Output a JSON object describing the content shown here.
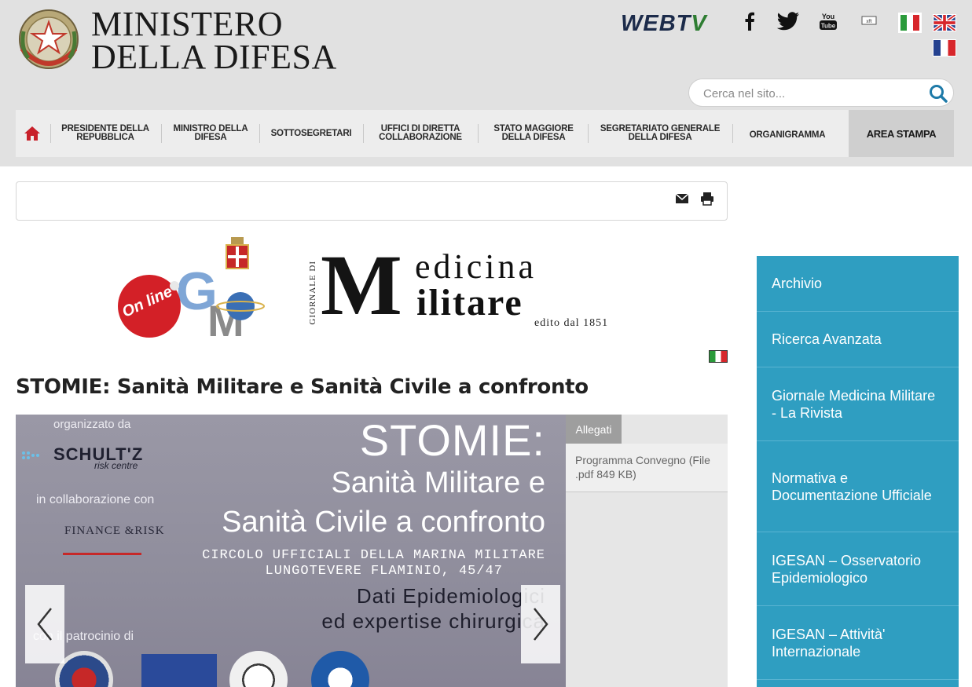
{
  "header": {
    "brand_line1": "MINISTERO",
    "brand_line2": "DELLA DIFESA",
    "emblem_icon": "repubblica-italiana-emblem",
    "webtv_label_a": "WEBT",
    "webtv_label_b": "V",
    "social": [
      {
        "name": "facebook-icon"
      },
      {
        "name": "twitter-icon"
      },
      {
        "name": "youtube-icon"
      },
      {
        "name": "rss-icon"
      }
    ],
    "languages": [
      "it",
      "en",
      "fr"
    ],
    "search_placeholder": "Cerca nel sito..."
  },
  "nav": {
    "home_icon": "home-icon",
    "items": [
      {
        "line1": "PRESIDENTE DELLA",
        "line2": "REPUBBLICA"
      },
      {
        "line1": "MINISTRO DELLA",
        "line2": "DIFESA"
      },
      {
        "line1": "SOTTOSEGRETARI",
        "line2": ""
      },
      {
        "line1": "UFFICI DI DIRETTA",
        "line2": "COLLABORAZIONE"
      },
      {
        "line1": "STATO MAGGIORE",
        "line2": "DELLA DIFESA"
      },
      {
        "line1": "SEGRETARIATO GENERALE",
        "line2": "DELLA DIFESA"
      },
      {
        "line1": "ORGANIGRAMMA",
        "line2": ""
      }
    ],
    "area_stampa": "AREA STAMPA"
  },
  "journal": {
    "side_text": "GIORNALE DI",
    "letter_m": "M",
    "word_medicina": "edicina",
    "word_militare": "ilitare",
    "edito": "edito dal 1851",
    "logo_badge": "On line",
    "colors": {
      "badge_red": "#d32027",
      "gmm_blue": "#3a6fb5"
    }
  },
  "article": {
    "title": "STOMIE: Sanità Militare e Sanità Civile a confronto"
  },
  "slider": {
    "organizzato": "organizzato da",
    "schultz": "SCHULT'Z",
    "risk": "risk centre",
    "collaborazione": "in collaborazione con",
    "finance": "FINANCE &RISK",
    "patrocinio": "con il patrocinio di",
    "title_stomie": "STOMIE:",
    "title_sanmil": "Sanità Militare e",
    "title_sanciv": "Sanità Civile a confronto",
    "circolo": "CIRCOLO UFFICIALI DELLA MARINA MILITARE",
    "lungotevere": "LUNGOTEVERE FLAMINIO, 45/47",
    "dati": "Dati Epidemiologici",
    "expertise": "ed expertise chirurgica",
    "prev_icon": "chevron-left-icon",
    "next_icon": "chevron-right-icon"
  },
  "allegati": {
    "tab": "Allegati",
    "item": "Programma Convegno (File .pdf 849 KB)"
  },
  "sidebar": {
    "color": "#2f9ec1",
    "items": [
      {
        "label": "Archivio"
      },
      {
        "label": "Ricerca Avanzata"
      },
      {
        "label": "Giornale Medicina Militare - La Rivista"
      },
      {
        "label": "Normativa e Documentazione Ufficiale"
      },
      {
        "label": "IGESAN – Osservatorio Epidemiologico"
      },
      {
        "label": "IGESAN – Attività' Internazionale"
      }
    ]
  },
  "toolbar": {
    "mail_icon": "mail-icon",
    "print_icon": "print-icon"
  }
}
